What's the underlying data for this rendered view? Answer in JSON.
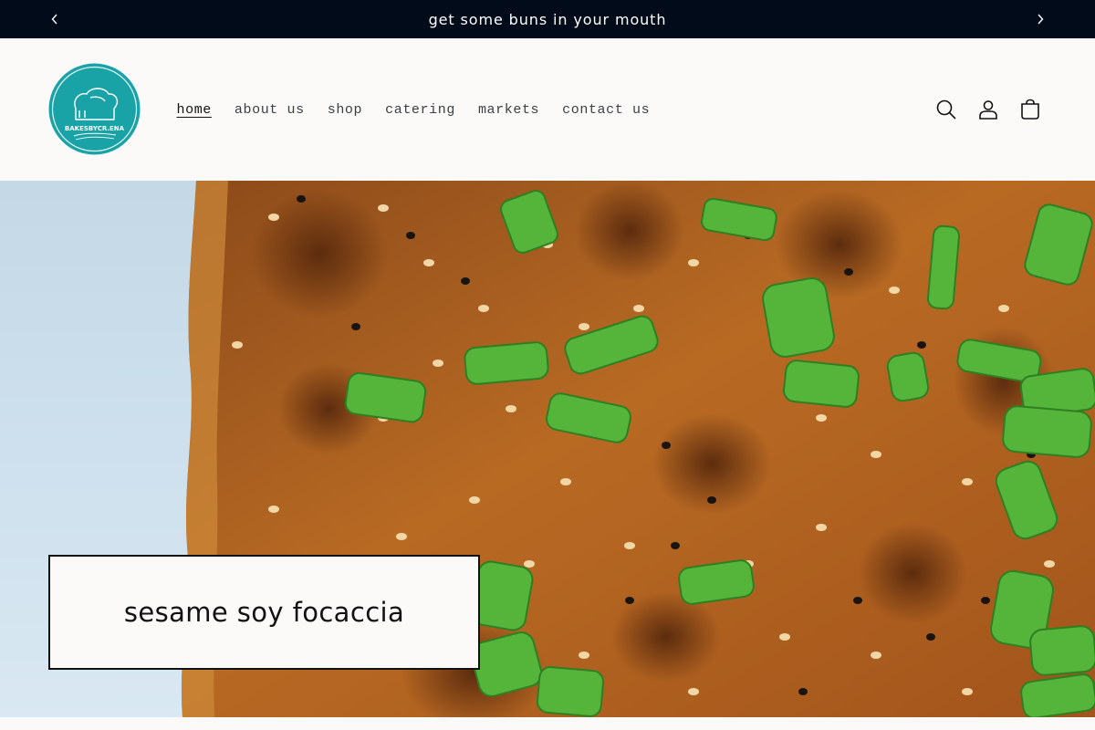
{
  "announcement": {
    "text": "get some buns in your mouth",
    "prev_icon": "chevron-left-icon",
    "next_icon": "chevron-right-icon"
  },
  "header": {
    "logo_text": "BAKESBYCR.ENA",
    "brand_color": "#1aa3a6",
    "nav": [
      {
        "label": "home",
        "active": true
      },
      {
        "label": "about us",
        "active": false
      },
      {
        "label": "shop",
        "active": false
      },
      {
        "label": "catering",
        "active": false
      },
      {
        "label": "markets",
        "active": false
      },
      {
        "label": "contact us",
        "active": false
      }
    ],
    "icons": [
      "search-icon",
      "account-icon",
      "cart-icon"
    ]
  },
  "hero": {
    "image_subject": "focaccia topped with sesame seeds and green onion",
    "caption_title": "sesame soy focaccia"
  },
  "colors": {
    "announcement_bg": "#020b1a",
    "page_bg": "#fbfaf9",
    "text": "#121212",
    "bread": "#b5621e"
  }
}
